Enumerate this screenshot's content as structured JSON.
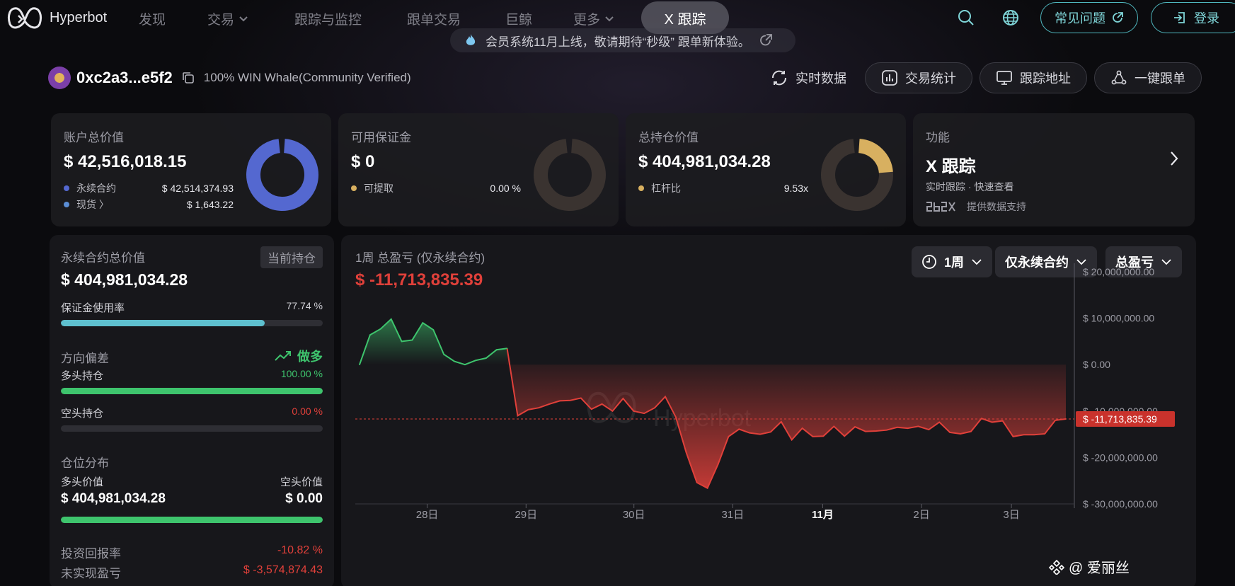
{
  "nav": {
    "brand": "Hyperbot",
    "items": [
      "发现",
      "交易",
      "跟踪与监控",
      "跟单交易",
      "巨鲸",
      "更多"
    ],
    "active_pill": "X 跟踪",
    "faq_label": "常见问题",
    "login_label": "登录"
  },
  "announcement": "会员系统11月上线，敬请期待“秒级” 跟单新体验。",
  "wallet": {
    "address": "0xc2a3...e5f2",
    "tag": "100% WIN Whale(Community Verified)"
  },
  "actions": {
    "realtime": "实时数据",
    "stats": "交易统计",
    "track": "跟踪地址",
    "copy": "一键跟单"
  },
  "cards": {
    "account": {
      "title": "账户总价值",
      "value": "$ 42,516,018.15",
      "rows": [
        {
          "label": "永续合约",
          "value": "$ 42,514,374.93"
        },
        {
          "label": "现货 〉",
          "value": "$ 1,643.22"
        }
      ]
    },
    "margin": {
      "title": "可用保证金",
      "value": "$ 0",
      "rows": [
        {
          "label": "可提取",
          "value": "0.00 %"
        }
      ]
    },
    "position": {
      "title": "总持仓价值",
      "value": "$ 404,981,034.28",
      "rows": [
        {
          "label": "杠杆比",
          "value": "9.53x"
        }
      ]
    },
    "feature": {
      "title": "功能",
      "value": "X 跟踪",
      "sub": "实时跟踪 · 快速查看",
      "provider": "提供数据支持"
    }
  },
  "left": {
    "perp_label": "永续合约总价值",
    "current_tag": "当前持仓",
    "perp_value": "$ 404,981,034.28",
    "margin_usage_label": "保证金使用率",
    "margin_usage_value": "77.74 %",
    "margin_usage_fraction": 0.7774,
    "bias_label": "方向偏差",
    "bias_value": "做多",
    "long_label": "多头持仓",
    "long_value": "100.00 %",
    "long_fraction": 1.0,
    "short_label": "空头持仓",
    "short_value": "0.00 %",
    "short_fraction": 0.0,
    "dist_label": "仓位分布",
    "long_val_label": "多头价值",
    "short_val_label": "空头价值",
    "long_val": "$ 404,981,034.28",
    "short_val": "$ 0.00",
    "roi_label": "投资回报率",
    "roi_value": "-10.82 %",
    "upnl_label": "未实现盈亏",
    "upnl_value": "$ -3,574,874.43"
  },
  "chart_panel": {
    "title": "1周 总盈亏 (仅永续合约)",
    "value": "$ -11,713,835.39",
    "dropdowns": [
      "1周",
      "仅永续合约",
      "总盈亏"
    ],
    "watermark_text": "Hyperbot"
  },
  "chart_data": {
    "type": "area",
    "y_ticks": [
      "$ 20,000,000.00",
      "$ 10,000,000.00",
      "$ 0.00",
      "$ -10,000,000.00",
      "$ -20,000,000.00",
      "$ -30,000,000.00"
    ],
    "ylim": [
      -30000000,
      20000000
    ],
    "x_ticks": [
      "28日",
      "29日",
      "30日",
      "31日",
      "11月",
      "2日",
      "3日"
    ],
    "current_label": "$ -11,713,835.39",
    "current_value": -11713835.39,
    "values": [
      0,
      6400000,
      7700000,
      9800000,
      5000000,
      5300000,
      9000000,
      7500000,
      2200000,
      700000,
      0,
      900000,
      1400000,
      3200000,
      3500000,
      -11000000,
      -9700000,
      -9300000,
      -8500000,
      -7800000,
      -7700000,
      -7200000,
      -9600000,
      -8500000,
      -10000000,
      -7300000,
      -10000000,
      -10500000,
      -9300000,
      -6900000,
      -11300000,
      -19000000,
      -25400000,
      -26600000,
      -21500000,
      -15500000,
      -13900000,
      -14700000,
      -15000000,
      -14500000,
      -12300000,
      -16200000,
      -13700000,
      -15500000,
      -15400000,
      -13300000,
      -15400000,
      -13400000,
      -14400000,
      -14300000,
      -14100000,
      -13500000,
      -13700000,
      -13300000,
      -14000000,
      -12400000,
      -14600000,
      -14900000,
      -14400000,
      -11600000,
      -12400000,
      -12100000,
      -15500000,
      -15100000,
      -15100000,
      -14900000,
      -12000000,
      -11700000
    ]
  },
  "colors": {
    "accent": "#4fb7be",
    "positive": "#3ec46d",
    "negative": "#e0403a",
    "account_ring": "#5468d0",
    "leverage_ring": "#d8b060"
  },
  "footer_watermark": "@ 爱丽丝"
}
